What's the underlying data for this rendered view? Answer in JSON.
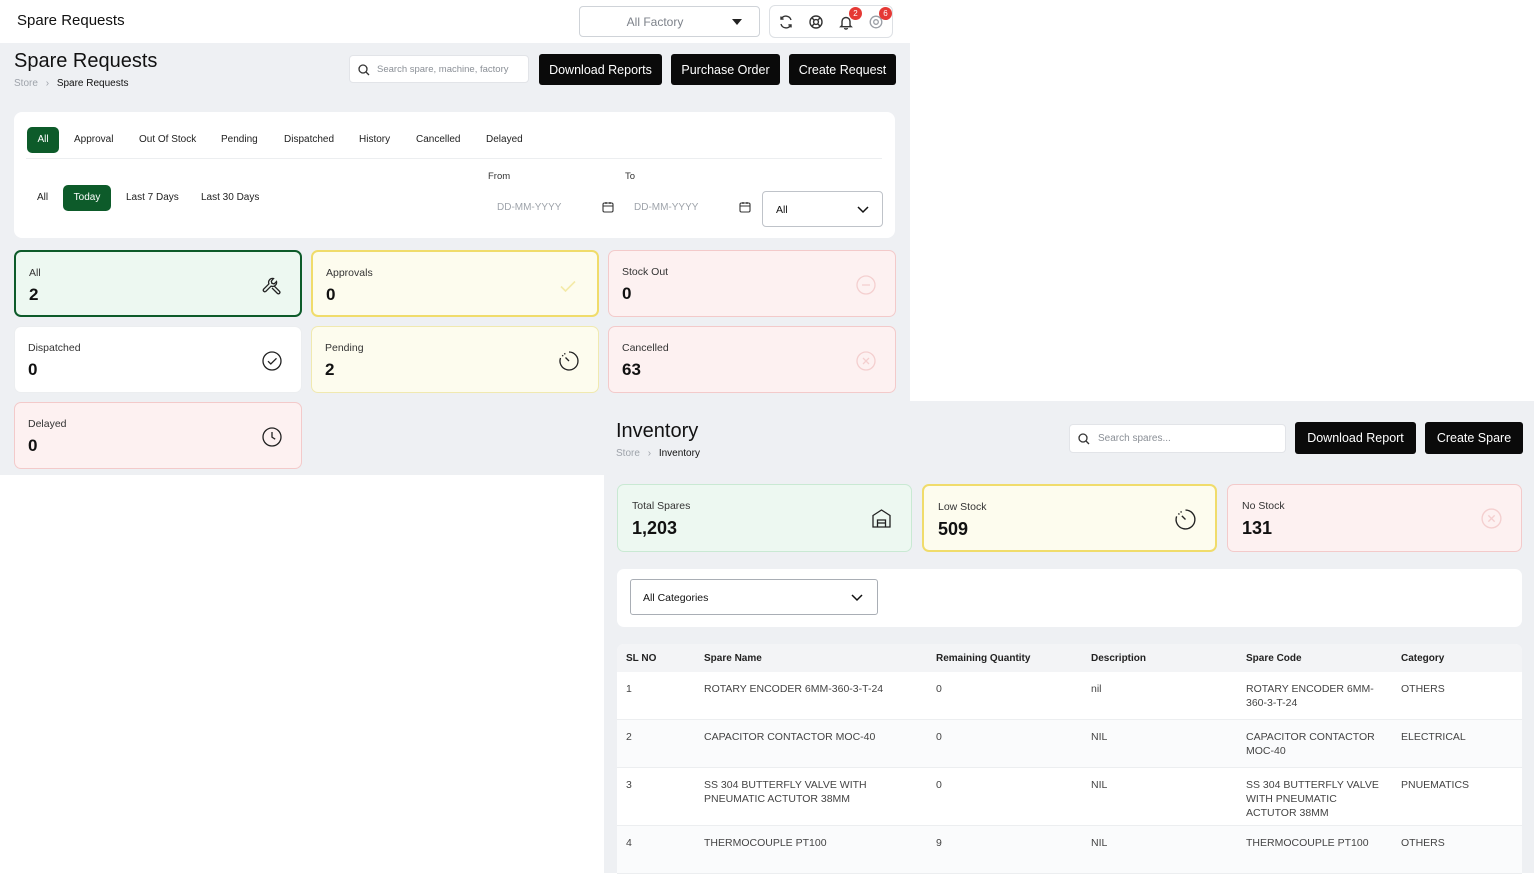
{
  "spare_requests": {
    "app_title": "Spare Requests",
    "factory_select": "All Factory",
    "badges": {
      "notifications": "2",
      "alerts": "6"
    },
    "page_title": "Spare Requests",
    "breadcrumb": {
      "root": "Store",
      "current": "Spare Requests"
    },
    "search_placeholder": "Search spare, machine, factory",
    "buttons": {
      "download": "Download Reports",
      "purchase": "Purchase Order",
      "create": "Create Request"
    },
    "status_tabs": [
      "All",
      "Approval",
      "Out Of Stock",
      "Pending",
      "Dispatched",
      "History",
      "Cancelled",
      "Delayed"
    ],
    "active_status_tab": "All",
    "range_tabs": [
      "All",
      "Today",
      "Last 7 Days",
      "Last 30 Days"
    ],
    "active_range_tab": "Today",
    "from_label": "From",
    "to_label": "To",
    "date_placeholder": "DD-MM-YYYY",
    "status_select": "All",
    "stats": [
      {
        "label": "All",
        "value": "2",
        "icon": "wrench-icon",
        "tone": "green"
      },
      {
        "label": "Approvals",
        "value": "0",
        "icon": "check-icon",
        "tone": "yellow"
      },
      {
        "label": "Stock Out",
        "value": "0",
        "icon": "minus-circle-icon",
        "tone": "red"
      },
      {
        "label": "Dispatched",
        "value": "0",
        "icon": "check-circle-icon",
        "tone": "white"
      },
      {
        "label": "Pending",
        "value": "2",
        "icon": "spinner-icon",
        "tone": "yellow"
      },
      {
        "label": "Cancelled",
        "value": "63",
        "icon": "x-circle-icon",
        "tone": "red"
      },
      {
        "label": "Delayed",
        "value": "0",
        "icon": "clock-icon",
        "tone": "red"
      }
    ]
  },
  "inventory": {
    "page_title": "Inventory",
    "breadcrumb": {
      "root": "Store",
      "current": "Inventory"
    },
    "search_placeholder": "Search spares...",
    "buttons": {
      "download": "Download Report",
      "create": "Create Spare"
    },
    "stats": [
      {
        "label": "Total Spares",
        "value": "1,203",
        "icon": "box-icon",
        "tone": "green"
      },
      {
        "label": "Low Stock",
        "value": "509",
        "icon": "spinner-icon",
        "tone": "yellow"
      },
      {
        "label": "No Stock",
        "value": "131",
        "icon": "x-circle-icon",
        "tone": "red"
      }
    ],
    "category_select": "All Categories",
    "table": {
      "headers": [
        "SL NO",
        "Spare Name",
        "Remaining Quantity",
        "Description",
        "Spare Code",
        "Category"
      ],
      "rows": [
        {
          "sl": "1",
          "name": "ROTARY ENCODER 6MM-360-3-T-24",
          "qty": "0",
          "desc": "nil",
          "code": "ROTARY ENCODER 6MM-360-3-T-24",
          "category": "OTHERS"
        },
        {
          "sl": "2",
          "name": "CAPACITOR CONTACTOR MOC-40",
          "qty": "0",
          "desc": "NIL",
          "code": "CAPACITOR CONTACTOR MOC-40",
          "category": "ELECTRICAL"
        },
        {
          "sl": "3",
          "name": "SS 304 BUTTERFLY VALVE WITH PNEUMATIC ACTUTOR 38MM",
          "qty": "0",
          "desc": "NIL",
          "code": "SS 304 BUTTERFLY VALVE WITH PNEUMATIC ACTUTOR 38MM",
          "category": "PNUEMATICS"
        },
        {
          "sl": "4",
          "name": "THERMOCOUPLE PT100",
          "qty": "9",
          "desc": "NIL",
          "code": "THERMOCOUPLE PT100",
          "category": "OTHERS"
        }
      ]
    }
  }
}
